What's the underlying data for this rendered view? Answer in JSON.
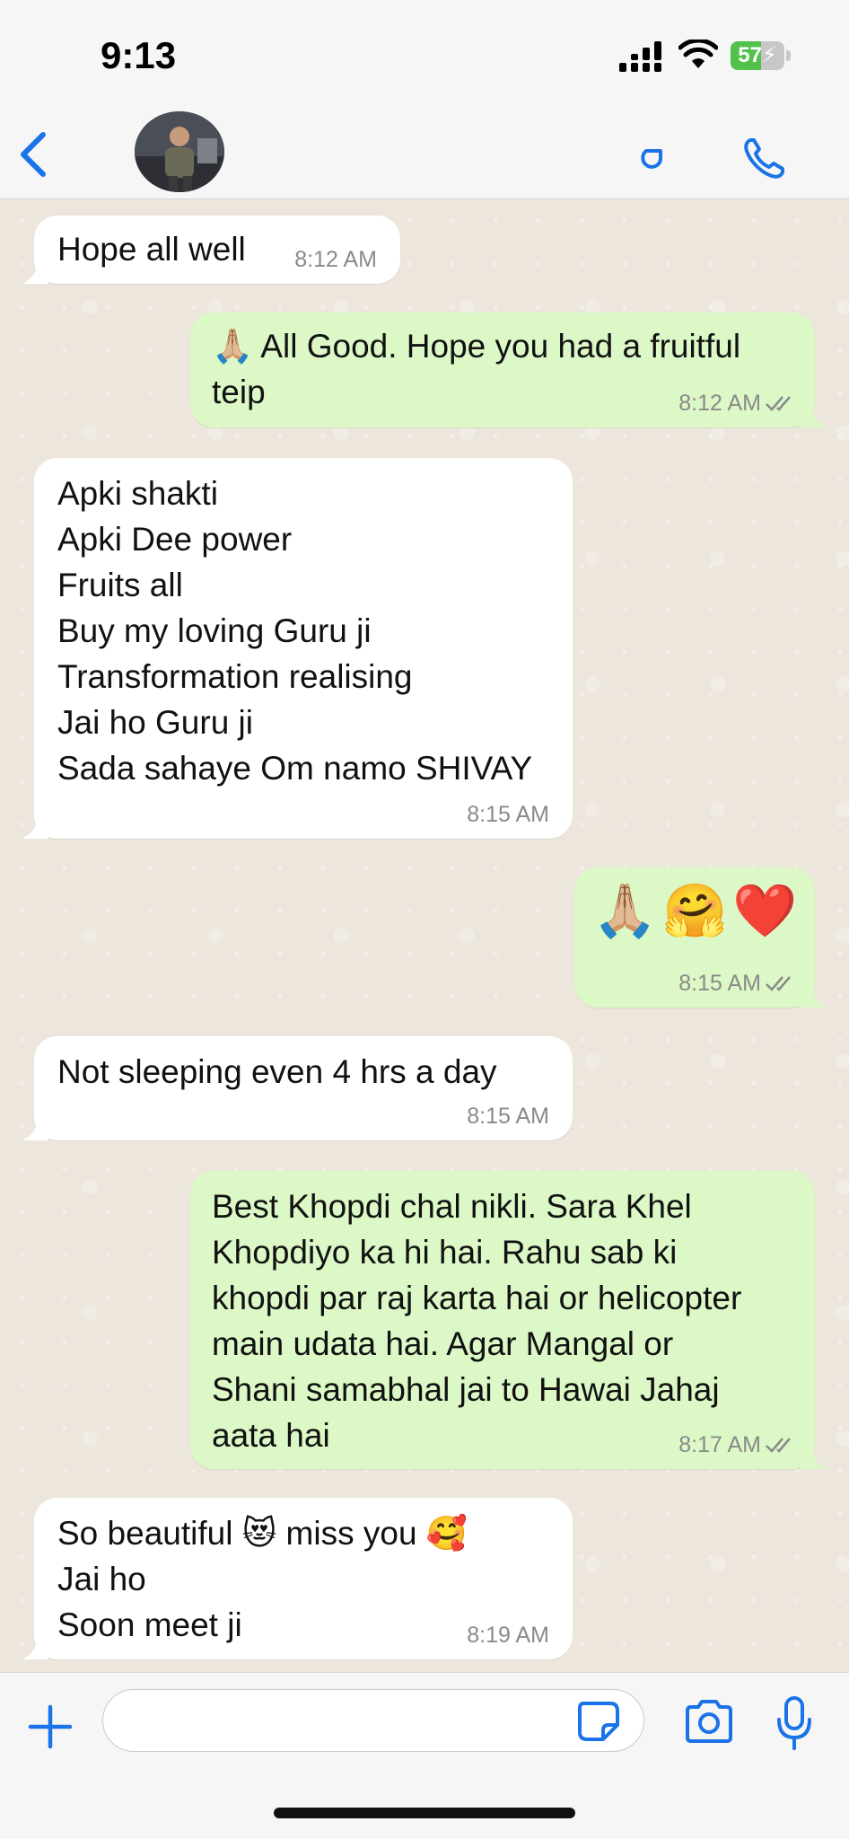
{
  "status_bar": {
    "time": "9:13",
    "battery_percent": "57",
    "battery_level": 0.57,
    "charging": true
  },
  "header": {
    "back_icon": "chevron-left-icon",
    "avatar": "contact-photo",
    "video_icon": "video-call-icon",
    "phone_icon": "phone-call-icon"
  },
  "messages": [
    {
      "direction": "in",
      "text": "Hope all well",
      "time": "8:12 AM"
    },
    {
      "direction": "out",
      "text": "🙏🏼 All Good. Hope you had a fruitful\nteip",
      "time": "8:12 AM",
      "status": "read"
    },
    {
      "direction": "in",
      "text": "Apki shakti\nApki Dee power\nFruits all\nBuy my loving Guru ji\nTransformation realising\nJai ho Guru ji\nSada sahaye Om namo SHIVAY",
      "time": "8:15 AM"
    },
    {
      "direction": "out",
      "text": "🙏🏼🤗❤️",
      "time": "8:15 AM",
      "status": "read"
    },
    {
      "direction": "in",
      "text": "Not sleeping even 4 hrs a day",
      "time": "8:15 AM"
    },
    {
      "direction": "out",
      "text": "Best Khopdi chal nikli. Sara Khel\nKhopdiyo ka hi hai. Rahu sab ki\nkhopdi par raj karta hai or helicopter\nmain udata hai. Agar Mangal or\nShani samabhal jai to Hawai Jahaj\naata hai",
      "time": "8:17 AM",
      "status": "read"
    },
    {
      "direction": "in",
      "text": "So beautiful 😻 miss you 🥰\nJai ho\nSoon meet ji",
      "time": "8:19 AM"
    }
  ],
  "input_bar": {
    "message_value": "",
    "plus_icon": "plus-icon",
    "sticker_icon": "sticker-icon",
    "camera_icon": "camera-icon",
    "mic_icon": "microphone-icon"
  },
  "colors": {
    "accent": "#1a73e8",
    "outgoing_bubble": "#dcf8c6",
    "incoming_bubble": "#ffffff",
    "chat_background": "#ece6dc",
    "read_ticks": "#8a8a8a"
  }
}
